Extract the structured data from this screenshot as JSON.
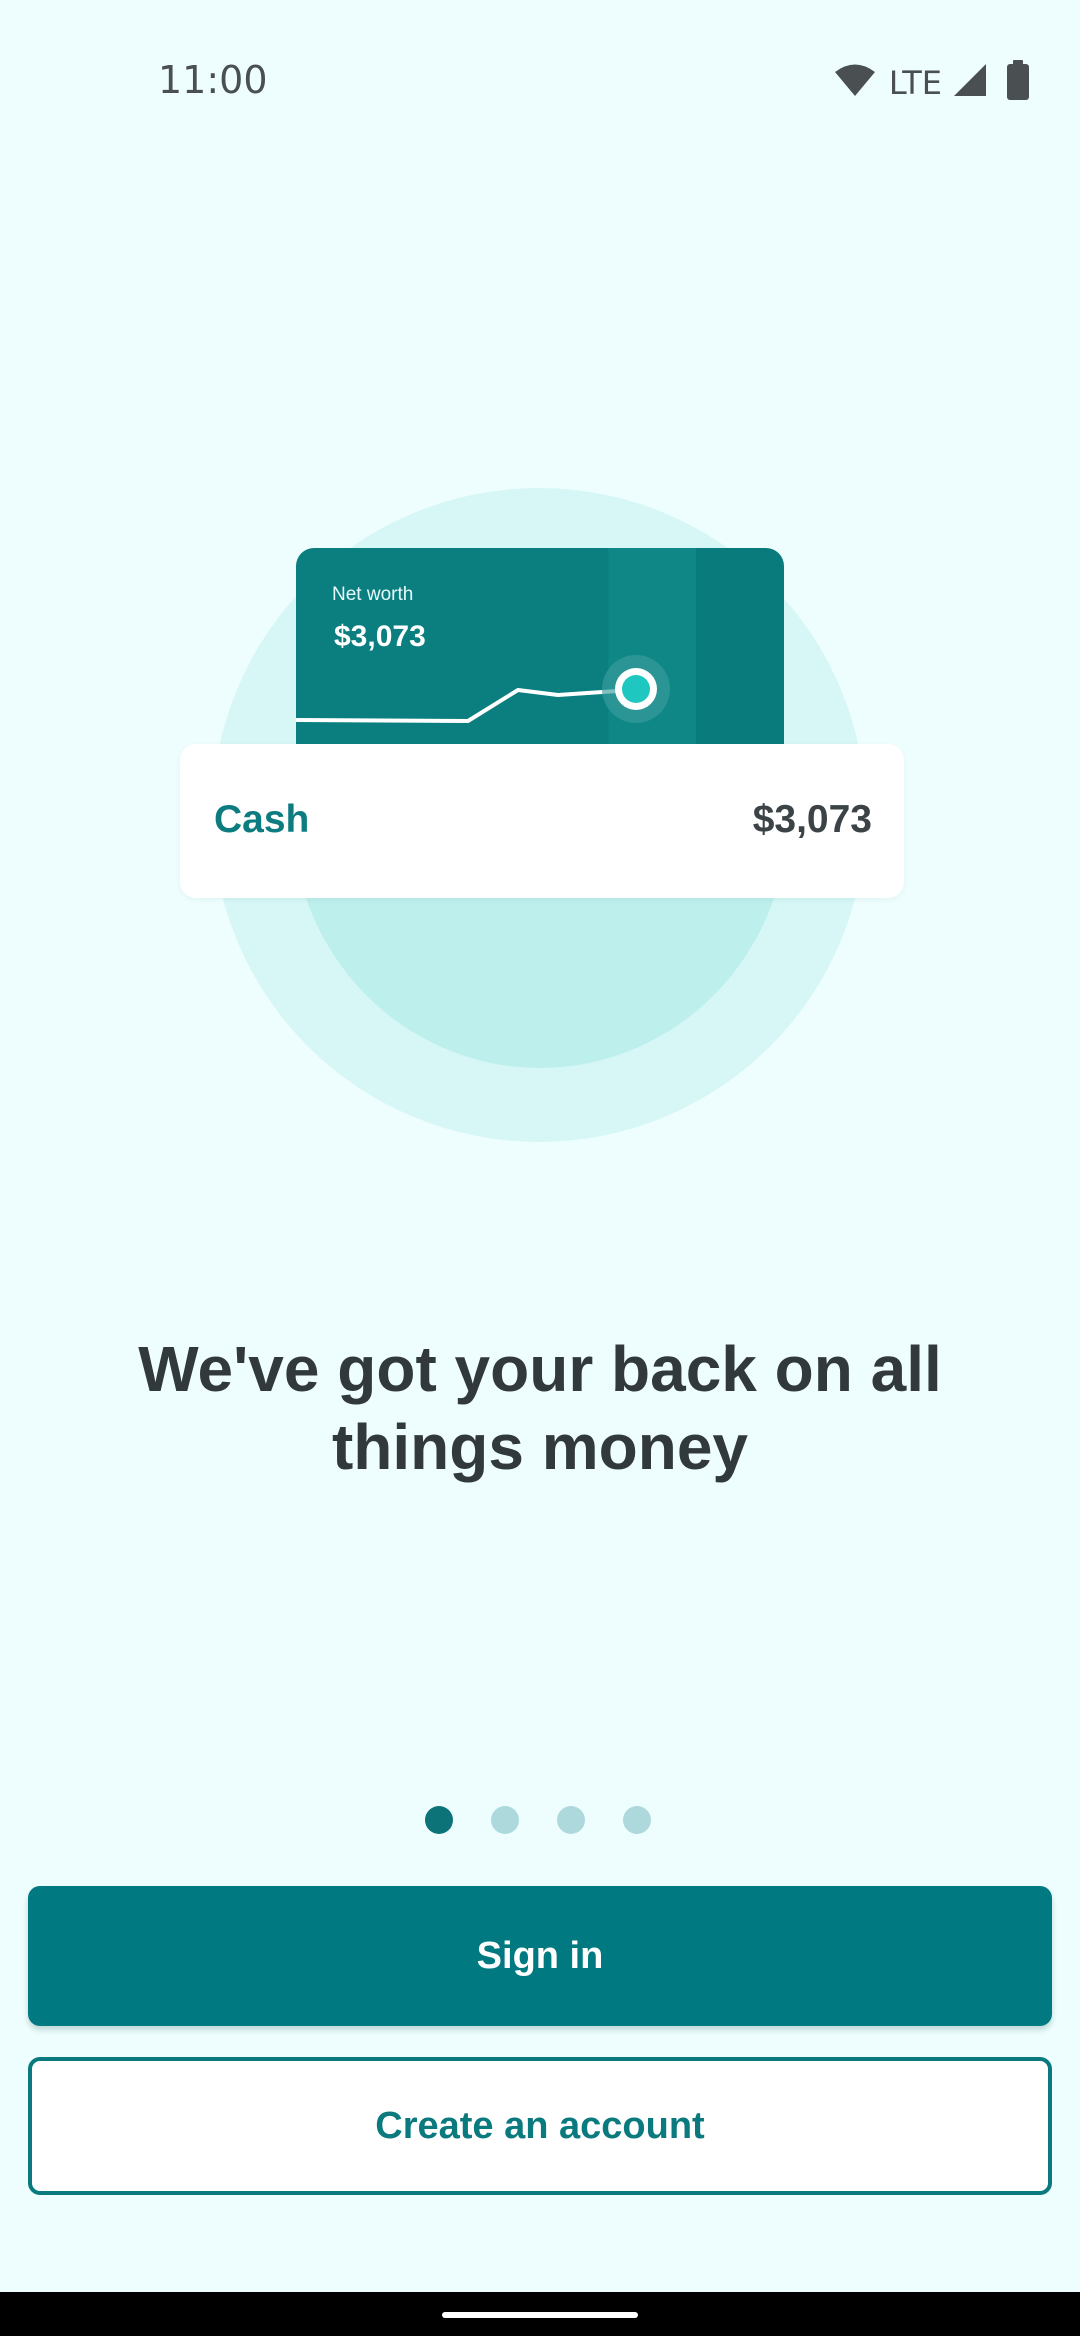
{
  "status_bar": {
    "time": "11:00",
    "network_label": "LTE",
    "icons": [
      "wifi-icon",
      "cellular-signal-icon",
      "battery-icon"
    ]
  },
  "illustration": {
    "networth_card": {
      "label": "Net worth",
      "value": "$3,073"
    },
    "cash_card": {
      "label": "Cash",
      "value": "$3,073"
    }
  },
  "headline": {
    "line1": "We've got your back on all",
    "line2": "things money"
  },
  "pager": {
    "total": 4,
    "active_index": 0
  },
  "actions": {
    "sign_in_label": "Sign in",
    "create_account_label": "Create an account"
  },
  "colors": {
    "background": "#eefefe",
    "primary": "#007a80",
    "accent_dot": "#1ec8c0",
    "text_dark": "#31393c"
  }
}
